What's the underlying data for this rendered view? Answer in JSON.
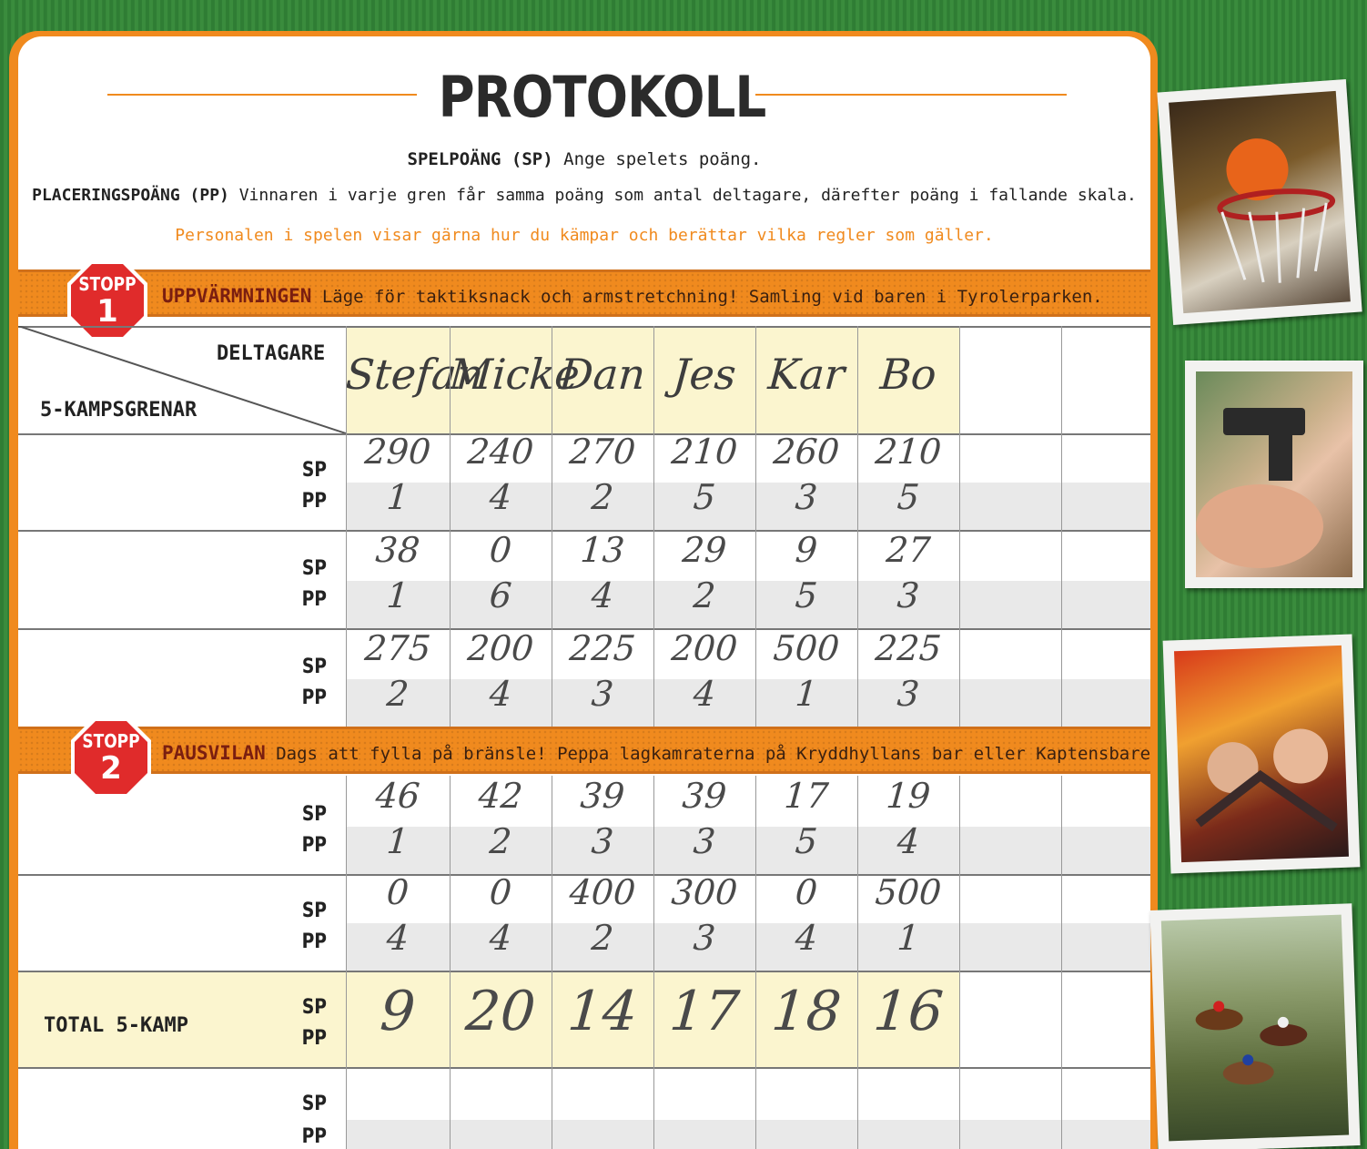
{
  "header": {
    "title": "PROTOKOLL",
    "sp_line_key": "SPELPOÄNG (SP)",
    "sp_line_text": " Ange spelets poäng.",
    "pp_line_key": "PLACERINGSPOÄNG (PP)",
    "pp_line_text": " Vinnaren i varje gren får samma poäng som antal deltagare, därefter poäng i fallande skala.",
    "note": "Personalen i spelen visar gärna hur du kämpar och berättar vilka regler som gäller."
  },
  "stop1": {
    "word": "STOPP",
    "number": "1",
    "title": "UPPVÄRMNINGEN",
    "text": " Läge för taktiksnack och armstretchning! Samling vid baren i Tyrolerparken."
  },
  "stop2": {
    "word": "STOPP",
    "number": "2",
    "title": "PAUSVILAN",
    "text": " Dags att fylla på bränsle! Peppa lagkamraterna på Kryddhyllans bar eller Kaptensbaren vid Kaskad."
  },
  "table": {
    "deltagare_label": "DELTAGARE",
    "grenar_label": "5-KAMPSGRENAR",
    "sp_label": "SP",
    "pp_label": "PP",
    "total_label": "TOTAL 5-KAMP",
    "participants": [
      "Stefan",
      "Micke",
      "Dan",
      "Jes",
      "Kar",
      "Bo"
    ],
    "rows": [
      {
        "sp": [
          "290",
          "240",
          "270",
          "210",
          "260",
          "210"
        ],
        "pp": [
          "1",
          "4",
          "2",
          "5",
          "3",
          "5"
        ]
      },
      {
        "sp": [
          "38",
          "0",
          "13",
          "29",
          "9",
          "27"
        ],
        "pp": [
          "1",
          "6",
          "4",
          "2",
          "5",
          "3"
        ]
      },
      {
        "sp": [
          "275",
          "200",
          "225",
          "200",
          "500",
          "225"
        ],
        "pp": [
          "2",
          "4",
          "3",
          "4",
          "1",
          "3"
        ]
      },
      {
        "sp": [
          "46",
          "42",
          "39",
          "39",
          "17",
          "19"
        ],
        "pp": [
          "1",
          "2",
          "3",
          "3",
          "5",
          "4"
        ]
      },
      {
        "sp": [
          "0",
          "0",
          "400",
          "300",
          "0",
          "500"
        ],
        "pp": [
          "4",
          "4",
          "2",
          "3",
          "4",
          "1"
        ]
      }
    ],
    "totals": [
      "9",
      "20",
      "14",
      "17",
      "18",
      "16"
    ]
  },
  "colors": {
    "orange": "#f08a1e",
    "stop_red": "#e02b2b",
    "band_title": "#7a1e10",
    "green_bg": "#2f7d34",
    "yellow_cell": "#fbf5cf"
  }
}
